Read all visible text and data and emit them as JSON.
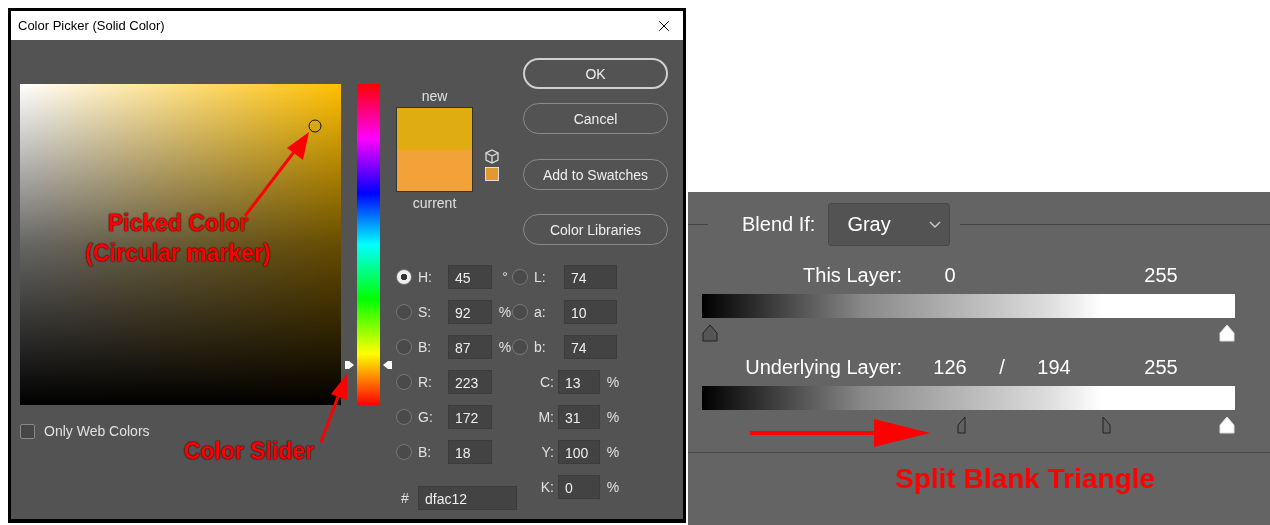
{
  "color_picker": {
    "title": "Color Picker (Solid Color)",
    "hue_slider": {
      "level": 0.125
    },
    "preview": {
      "new_label": "new",
      "current_label": "current"
    },
    "buttons": [
      {
        "label": "OK",
        "default": true
      },
      {
        "label": "Cancel",
        "default": false
      },
      {
        "label": "Add to Swatches",
        "default": false
      },
      {
        "label": "Color Libraries",
        "default": false
      }
    ],
    "only_web_colors": {
      "label": "Only Web Colors",
      "checked": false
    },
    "left_fields": [
      {
        "label": "H:",
        "value": "45",
        "unit": "°",
        "selected": true
      },
      {
        "label": "S:",
        "value": "92",
        "unit": "%",
        "selected": false
      },
      {
        "label": "B:",
        "value": "87",
        "unit": "%",
        "selected": false
      },
      {
        "label": "R:",
        "value": "223",
        "selected": false
      },
      {
        "label": "G:",
        "value": "172",
        "selected": false
      },
      {
        "label": "B:",
        "value": "18",
        "selected": false
      }
    ],
    "right_fields": [
      {
        "kind": "radio",
        "label": "L:",
        "value": "74",
        "selected": false
      },
      {
        "kind": "radio",
        "label": "a:",
        "value": "10",
        "selected": false
      },
      {
        "kind": "radio",
        "label": "b:",
        "value": "74",
        "selected": false
      },
      {
        "kind": "plain",
        "label": "C:",
        "value": "13",
        "unit": "%"
      },
      {
        "kind": "plain",
        "label": "M:",
        "value": "31",
        "unit": "%"
      },
      {
        "kind": "plain",
        "label": "Y:",
        "value": "100",
        "unit": "%"
      },
      {
        "kind": "plain",
        "label": "K:",
        "value": "0",
        "unit": "%"
      }
    ],
    "hex": {
      "label": "#",
      "value": "dfac12"
    },
    "annotations": [
      {
        "text": "Picked Color\n(Circular marker)"
      },
      {
        "text": "Color Slider"
      }
    ]
  },
  "blend_panel": {
    "blend_if": {
      "label": "Blend If:",
      "value": "Gray"
    },
    "rows": [
      {
        "label": "This Layer:",
        "values": [
          "0",
          "255"
        ],
        "handles": [
          {
            "kind": "dark",
            "level": 0
          },
          {
            "kind": "light",
            "level": 1
          }
        ]
      },
      {
        "label": "Underlying Layer:",
        "values": [
          "126",
          "/",
          "194",
          "255"
        ],
        "handles": [
          {
            "kind": "split-left",
            "level": 0.494
          },
          {
            "kind": "split-right",
            "level": 0.761
          },
          {
            "kind": "light",
            "level": 1
          }
        ]
      }
    ],
    "annotation": {
      "text": "Split Blank Triangle"
    }
  }
}
